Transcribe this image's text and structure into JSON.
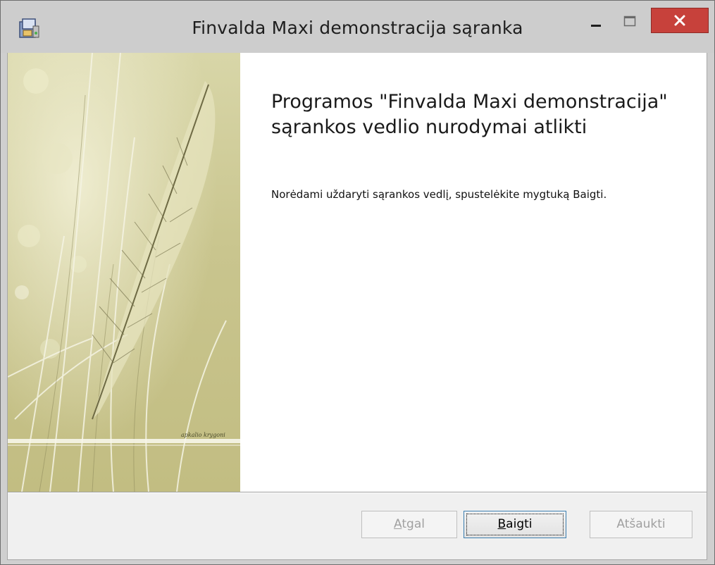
{
  "window": {
    "title": "Finvalda Maxi demonstracija sąranka"
  },
  "main": {
    "heading": "Programos \"Finvalda Maxi demonstracija\" sąrankos vedlio nurodymai atlikti",
    "body": "Norėdami uždaryti sąrankos vedlį, spustelėkite mygtuką Baigti.",
    "image_signature": "apkalio krygoni"
  },
  "footer": {
    "back_label_accel": "A",
    "back_label_rest": "tgal",
    "finish_label_accel": "B",
    "finish_label_rest": "aigti",
    "cancel_label": "Atšaukti"
  },
  "colors": {
    "close_button": "#c7413b",
    "focus_border": "#3c7fb1",
    "image_tint": "#c9c58e"
  },
  "icons": [
    "installer-icon",
    "minimize-icon",
    "maximize-icon",
    "close-icon"
  ]
}
